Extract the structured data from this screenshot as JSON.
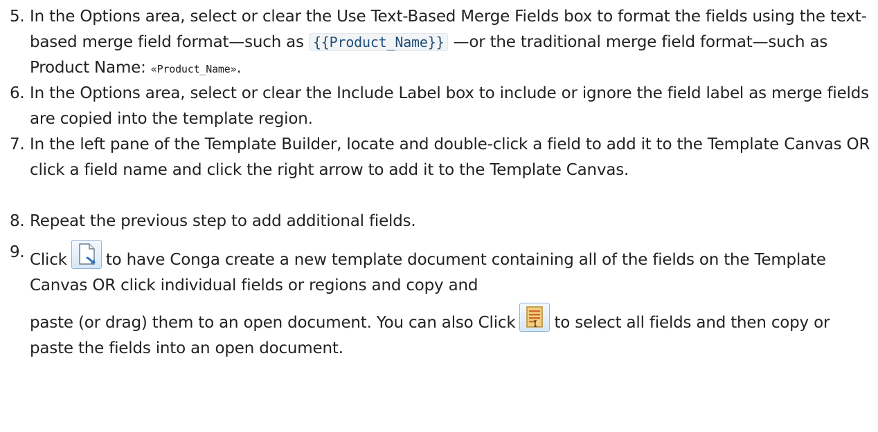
{
  "steps": [
    {
      "number": "5.",
      "text_a": "In the Options area, select or clear the Use Text-Based Merge Fields box to format the fields using the text-based merge field format—such as ",
      "code_text": "{{Product_Name}}",
      "text_b": " —or the traditional merge field format—such as Product Name: ",
      "code_small": "«Product_Name»",
      "text_c": "."
    },
    {
      "number": "6.",
      "text": "In the Options area, select or clear the Include Label box to include or ignore the field label as merge fields are copied into the template region."
    },
    {
      "number": "7.",
      "text": "In the left pane of the Template Builder, locate and double-click a field to add it to the Template Canvas OR click a field name and click the right arrow to add it to the Template Canvas."
    },
    {
      "number": "8.",
      "text": "Repeat the previous step to add additional fields."
    },
    {
      "number": "9.",
      "text_a": "Click",
      "text_b": "to have Conga create a new template document containing all of the fields on the Template Canvas OR click individual fields or regions and copy and",
      "text_c": "paste (or drag) them to an open document. You can also Click",
      "text_d": "to select all fields and then copy or paste the fields into an open document.",
      "icon_1": "new-template-document-icon",
      "icon_2": "select-all-fields-icon"
    }
  ]
}
